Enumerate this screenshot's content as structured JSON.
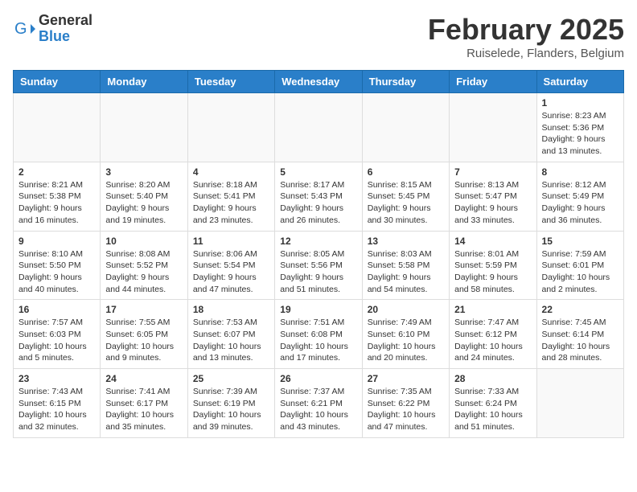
{
  "header": {
    "logo_general": "General",
    "logo_blue": "Blue",
    "month_title": "February 2025",
    "location": "Ruiselede, Flanders, Belgium"
  },
  "days_of_week": [
    "Sunday",
    "Monday",
    "Tuesday",
    "Wednesday",
    "Thursday",
    "Friday",
    "Saturday"
  ],
  "weeks": [
    [
      {
        "day": "",
        "info": ""
      },
      {
        "day": "",
        "info": ""
      },
      {
        "day": "",
        "info": ""
      },
      {
        "day": "",
        "info": ""
      },
      {
        "day": "",
        "info": ""
      },
      {
        "day": "",
        "info": ""
      },
      {
        "day": "1",
        "info": "Sunrise: 8:23 AM\nSunset: 5:36 PM\nDaylight: 9 hours and 13 minutes."
      }
    ],
    [
      {
        "day": "2",
        "info": "Sunrise: 8:21 AM\nSunset: 5:38 PM\nDaylight: 9 hours and 16 minutes."
      },
      {
        "day": "3",
        "info": "Sunrise: 8:20 AM\nSunset: 5:40 PM\nDaylight: 9 hours and 19 minutes."
      },
      {
        "day": "4",
        "info": "Sunrise: 8:18 AM\nSunset: 5:41 PM\nDaylight: 9 hours and 23 minutes."
      },
      {
        "day": "5",
        "info": "Sunrise: 8:17 AM\nSunset: 5:43 PM\nDaylight: 9 hours and 26 minutes."
      },
      {
        "day": "6",
        "info": "Sunrise: 8:15 AM\nSunset: 5:45 PM\nDaylight: 9 hours and 30 minutes."
      },
      {
        "day": "7",
        "info": "Sunrise: 8:13 AM\nSunset: 5:47 PM\nDaylight: 9 hours and 33 minutes."
      },
      {
        "day": "8",
        "info": "Sunrise: 8:12 AM\nSunset: 5:49 PM\nDaylight: 9 hours and 36 minutes."
      }
    ],
    [
      {
        "day": "9",
        "info": "Sunrise: 8:10 AM\nSunset: 5:50 PM\nDaylight: 9 hours and 40 minutes."
      },
      {
        "day": "10",
        "info": "Sunrise: 8:08 AM\nSunset: 5:52 PM\nDaylight: 9 hours and 44 minutes."
      },
      {
        "day": "11",
        "info": "Sunrise: 8:06 AM\nSunset: 5:54 PM\nDaylight: 9 hours and 47 minutes."
      },
      {
        "day": "12",
        "info": "Sunrise: 8:05 AM\nSunset: 5:56 PM\nDaylight: 9 hours and 51 minutes."
      },
      {
        "day": "13",
        "info": "Sunrise: 8:03 AM\nSunset: 5:58 PM\nDaylight: 9 hours and 54 minutes."
      },
      {
        "day": "14",
        "info": "Sunrise: 8:01 AM\nSunset: 5:59 PM\nDaylight: 9 hours and 58 minutes."
      },
      {
        "day": "15",
        "info": "Sunrise: 7:59 AM\nSunset: 6:01 PM\nDaylight: 10 hours and 2 minutes."
      }
    ],
    [
      {
        "day": "16",
        "info": "Sunrise: 7:57 AM\nSunset: 6:03 PM\nDaylight: 10 hours and 5 minutes."
      },
      {
        "day": "17",
        "info": "Sunrise: 7:55 AM\nSunset: 6:05 PM\nDaylight: 10 hours and 9 minutes."
      },
      {
        "day": "18",
        "info": "Sunrise: 7:53 AM\nSunset: 6:07 PM\nDaylight: 10 hours and 13 minutes."
      },
      {
        "day": "19",
        "info": "Sunrise: 7:51 AM\nSunset: 6:08 PM\nDaylight: 10 hours and 17 minutes."
      },
      {
        "day": "20",
        "info": "Sunrise: 7:49 AM\nSunset: 6:10 PM\nDaylight: 10 hours and 20 minutes."
      },
      {
        "day": "21",
        "info": "Sunrise: 7:47 AM\nSunset: 6:12 PM\nDaylight: 10 hours and 24 minutes."
      },
      {
        "day": "22",
        "info": "Sunrise: 7:45 AM\nSunset: 6:14 PM\nDaylight: 10 hours and 28 minutes."
      }
    ],
    [
      {
        "day": "23",
        "info": "Sunrise: 7:43 AM\nSunset: 6:15 PM\nDaylight: 10 hours and 32 minutes."
      },
      {
        "day": "24",
        "info": "Sunrise: 7:41 AM\nSunset: 6:17 PM\nDaylight: 10 hours and 35 minutes."
      },
      {
        "day": "25",
        "info": "Sunrise: 7:39 AM\nSunset: 6:19 PM\nDaylight: 10 hours and 39 minutes."
      },
      {
        "day": "26",
        "info": "Sunrise: 7:37 AM\nSunset: 6:21 PM\nDaylight: 10 hours and 43 minutes."
      },
      {
        "day": "27",
        "info": "Sunrise: 7:35 AM\nSunset: 6:22 PM\nDaylight: 10 hours and 47 minutes."
      },
      {
        "day": "28",
        "info": "Sunrise: 7:33 AM\nSunset: 6:24 PM\nDaylight: 10 hours and 51 minutes."
      },
      {
        "day": "",
        "info": ""
      }
    ]
  ]
}
